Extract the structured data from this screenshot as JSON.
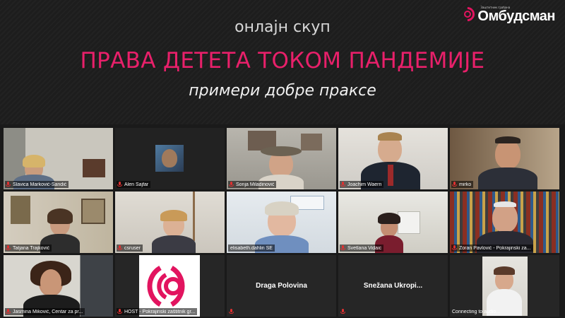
{
  "banner": {
    "subtitle": "онлајн скуп",
    "title": "ПРАВА ДЕТЕТА ТОКОМ ПАНДЕМИЈЕ",
    "tagline": "примери добре праксе",
    "logo_small": "Заштитник грађана",
    "logo_name": "Омбудсман"
  },
  "colors": {
    "accent": "#e8206a",
    "active_speaker": "#8fd14a",
    "muted_mic": "#e03030"
  },
  "participants": [
    {
      "name": "Slavica Marković-Sandić",
      "muted": true
    },
    {
      "name": "Alen Šajfar",
      "muted": true
    },
    {
      "name": "Sonja Miladinović",
      "muted": true
    },
    {
      "name": "Joachim Waern",
      "muted": true
    },
    {
      "name": "mirko",
      "muted": true
    },
    {
      "name": "Tatjana Trajković",
      "muted": true
    },
    {
      "name": "csruser",
      "muted": true
    },
    {
      "name": "elisabeth.dahlin SE",
      "muted": false,
      "active_speaker": true
    },
    {
      "name": "Svetlana Vidaic",
      "muted": true
    },
    {
      "name": "Zoran Pavlović - Pokrajinski za...",
      "muted": true
    },
    {
      "name": "Jasmina Miković, Centar za pr...",
      "muted": true
    },
    {
      "name": "HOST - Pokrajinski zaštitnik gr...",
      "muted": true
    },
    {
      "name": "Draga Polovina",
      "muted": true
    },
    {
      "name": "Snežana Ukropi...",
      "muted": true
    },
    {
      "name": "Connecting to audio...",
      "muted": false
    }
  ]
}
